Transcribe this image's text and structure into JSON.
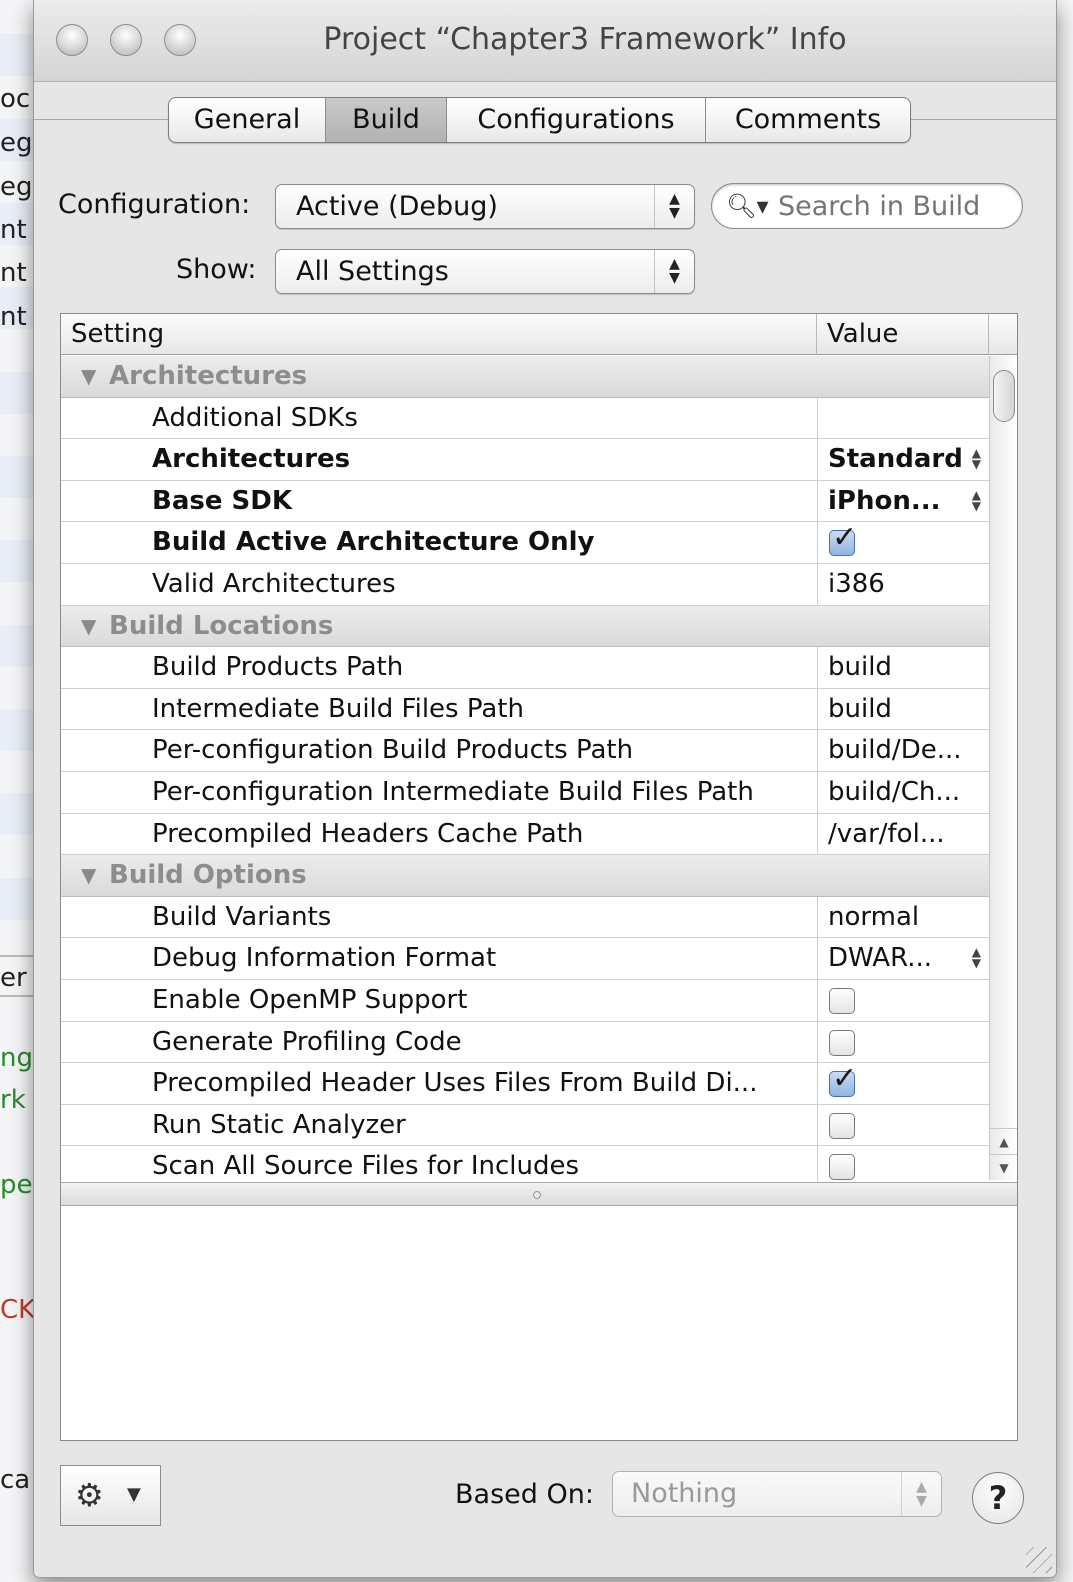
{
  "background": {
    "fragments": [
      "oc",
      "eg",
      "eg",
      "nt",
      "nt",
      "nt",
      "er",
      "ng",
      "rk",
      "pe",
      "CK",
      "ca"
    ]
  },
  "window": {
    "title": "Project “Chapter3 Framework” Info"
  },
  "tabs": [
    {
      "label": "General",
      "active": false
    },
    {
      "label": "Build",
      "active": true
    },
    {
      "label": "Configurations",
      "active": false
    },
    {
      "label": "Comments",
      "active": false
    }
  ],
  "controls": {
    "configuration_label": "Configuration:",
    "configuration_value": "Active (Debug)",
    "show_label": "Show:",
    "show_value": "All Settings",
    "search_placeholder": "Search in Build"
  },
  "table": {
    "col_setting": "Setting",
    "col_value": "Value",
    "rows": [
      {
        "type": "group",
        "name": "Architectures"
      },
      {
        "type": "setting",
        "name": "Additional SDKs",
        "value": "",
        "bold": false
      },
      {
        "type": "setting",
        "name": "Architectures",
        "value": "Standard",
        "bold": true,
        "popup": true
      },
      {
        "type": "setting",
        "name": "Base SDK",
        "value": "iPhon...",
        "bold": true,
        "popup": true
      },
      {
        "type": "setting",
        "name": "Build Active Architecture Only",
        "checkbox": true,
        "checked": true,
        "bold": true
      },
      {
        "type": "setting",
        "name": "Valid Architectures",
        "value": "i386",
        "bold": false
      },
      {
        "type": "group",
        "name": "Build Locations"
      },
      {
        "type": "setting",
        "name": "Build Products Path",
        "value": "build",
        "bold": false
      },
      {
        "type": "setting",
        "name": "Intermediate Build Files Path",
        "value": "build",
        "bold": false
      },
      {
        "type": "setting",
        "name": "Per-configuration Build Products Path",
        "value": "build/De...",
        "bold": false
      },
      {
        "type": "setting",
        "name": "Per-configuration Intermediate Build Files Path",
        "value": "build/Ch...",
        "bold": false
      },
      {
        "type": "setting",
        "name": "Precompiled Headers Cache Path",
        "value": "/var/fol...",
        "bold": false
      },
      {
        "type": "group",
        "name": "Build Options"
      },
      {
        "type": "setting",
        "name": "Build Variants",
        "value": "normal",
        "bold": false
      },
      {
        "type": "setting",
        "name": "Debug Information Format",
        "value": "DWAR...",
        "bold": false,
        "popup": true
      },
      {
        "type": "setting",
        "name": "Enable OpenMP Support",
        "checkbox": true,
        "checked": false,
        "bold": false
      },
      {
        "type": "setting",
        "name": "Generate Profiling Code",
        "checkbox": true,
        "checked": false,
        "bold": false
      },
      {
        "type": "setting",
        "name": "Precompiled Header Uses Files From Build Di...",
        "checkbox": true,
        "checked": true,
        "bold": false
      },
      {
        "type": "setting",
        "name": "Run Static Analyzer",
        "checkbox": true,
        "checked": false,
        "bold": false
      },
      {
        "type": "setting",
        "name": "Scan All Source Files for Includes",
        "checkbox": true,
        "checked": false,
        "bold": false
      }
    ]
  },
  "footer": {
    "based_on_label": "Based On:",
    "based_on_value": "Nothing",
    "help_label": "?"
  },
  "icons": {
    "gear": "gear-icon",
    "search": "search-icon",
    "help": "help-icon"
  }
}
